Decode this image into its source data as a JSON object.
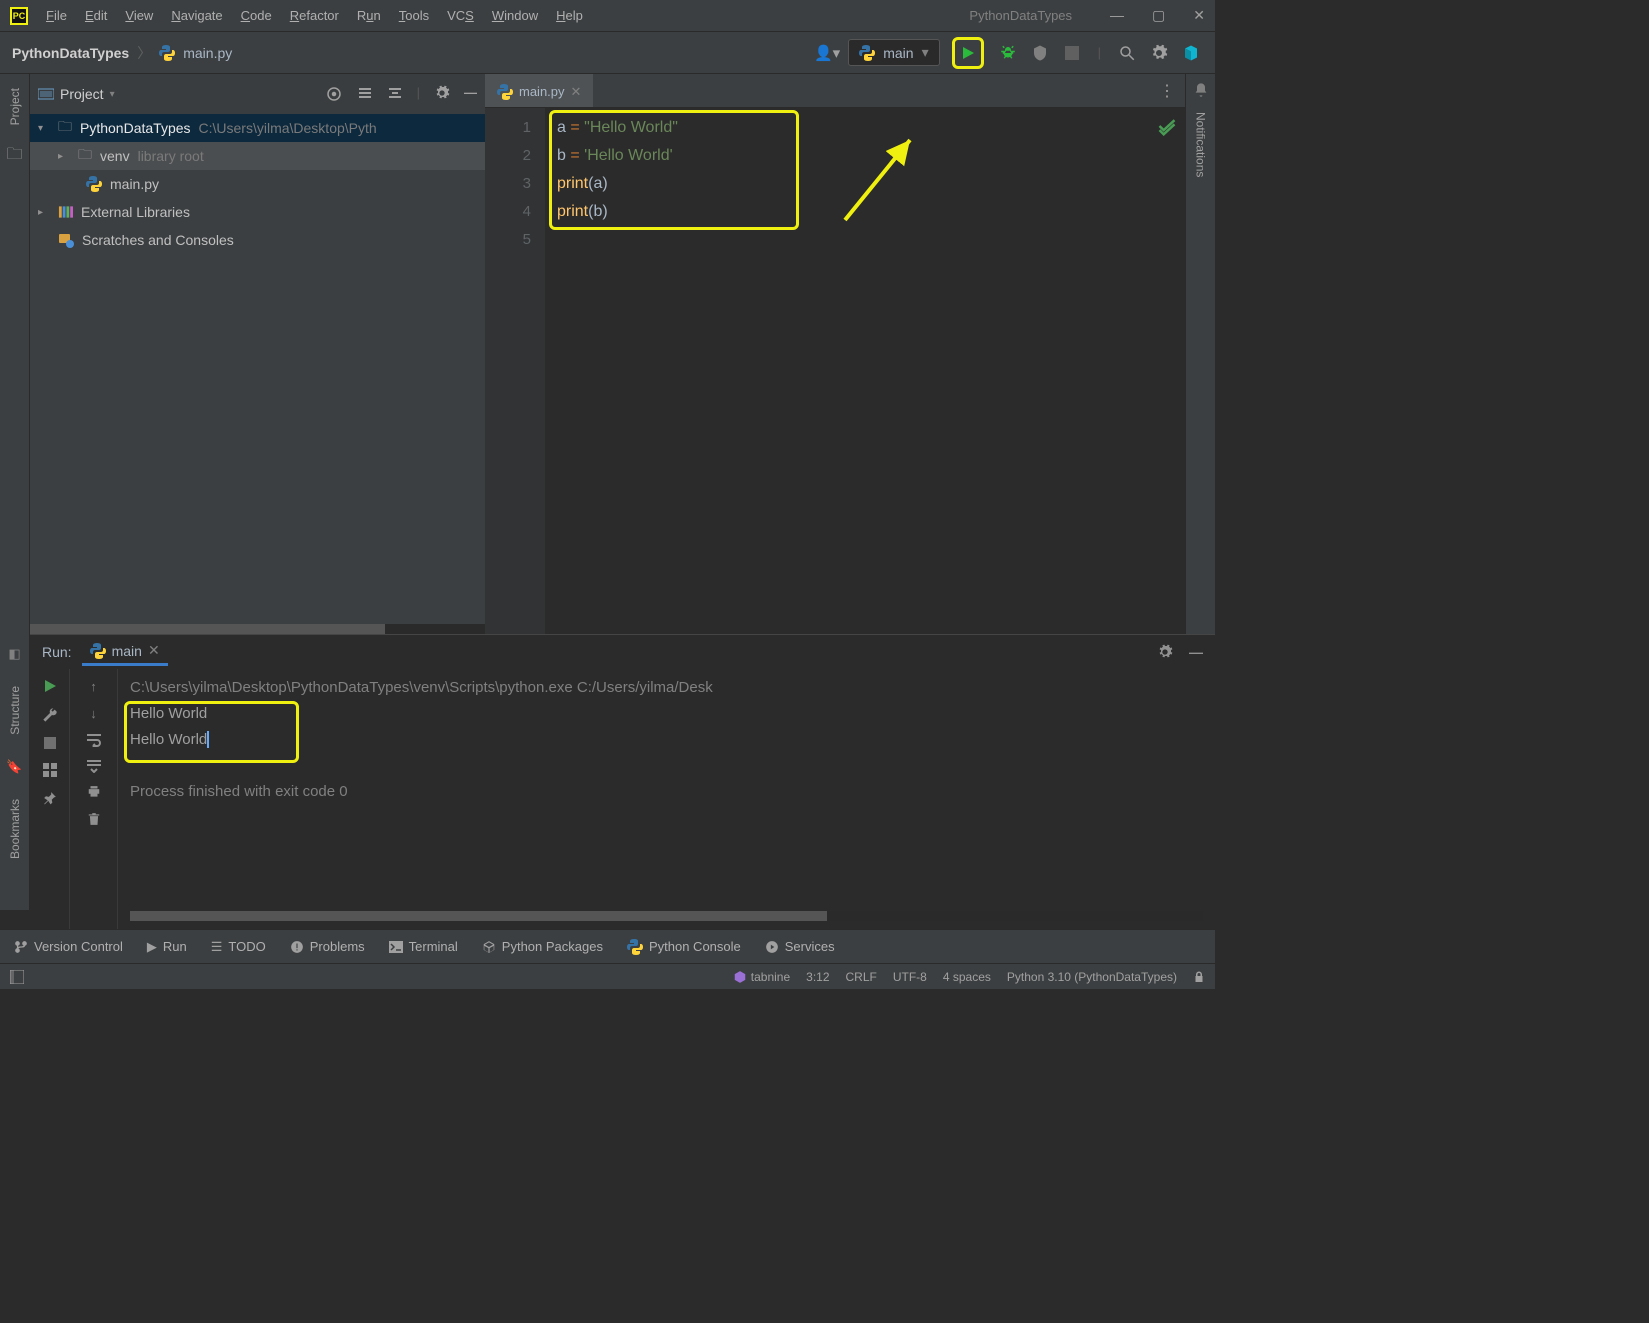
{
  "title": "PythonDataTypes",
  "menu": [
    "File",
    "Edit",
    "View",
    "Navigate",
    "Code",
    "Refactor",
    "Run",
    "Tools",
    "VCS",
    "Window",
    "Help"
  ],
  "breadcrumb": {
    "root": "PythonDataTypes",
    "file": "main.py"
  },
  "run_config": {
    "label": "main"
  },
  "project_panel": {
    "title": "Project"
  },
  "tree": {
    "root": {
      "name": "PythonDataTypes",
      "path": "C:\\Users\\yilma\\Desktop\\Pyth"
    },
    "venv": {
      "name": "venv",
      "hint": "library root"
    },
    "file": {
      "name": "main.py"
    },
    "ext": {
      "name": "External Libraries"
    },
    "scratch": {
      "name": "Scratches and Consoles"
    }
  },
  "editor": {
    "tab": "main.py",
    "lines": [
      "1",
      "2",
      "3",
      "4",
      "5"
    ],
    "code": {
      "l1a": "a ",
      "l1b": "= ",
      "l1c": "\"Hello World\"",
      "l2a": "b ",
      "l2b": "= ",
      "l2c": "'Hello World'",
      "l3a": "print",
      "l3b": "(",
      "l3c": "a",
      "l3d": ")",
      "l4a": "print",
      "l4b": "(",
      "l4c": "b",
      "l4d": ")"
    }
  },
  "run": {
    "title": "Run:",
    "tab": "main",
    "console": {
      "cmd": "C:\\Users\\yilma\\Desktop\\PythonDataTypes\\venv\\Scripts\\python.exe C:/Users/yilma/Desk",
      "out1": "Hello World",
      "out2": "Hello World",
      "exit": "Process finished with exit code 0"
    }
  },
  "bottom": {
    "vc": "Version Control",
    "run": "Run",
    "todo": "TODO",
    "problems": "Problems",
    "terminal": "Terminal",
    "pkg": "Python Packages",
    "pycon": "Python Console",
    "svc": "Services"
  },
  "status": {
    "tabnine": "tabnine",
    "pos": "3:12",
    "eol": "CRLF",
    "enc": "UTF-8",
    "indent": "4 spaces",
    "interp": "Python 3.10 (PythonDataTypes)"
  },
  "rail": {
    "project": "Project",
    "notifications": "Notifications",
    "structure": "Structure",
    "bookmarks": "Bookmarks"
  }
}
